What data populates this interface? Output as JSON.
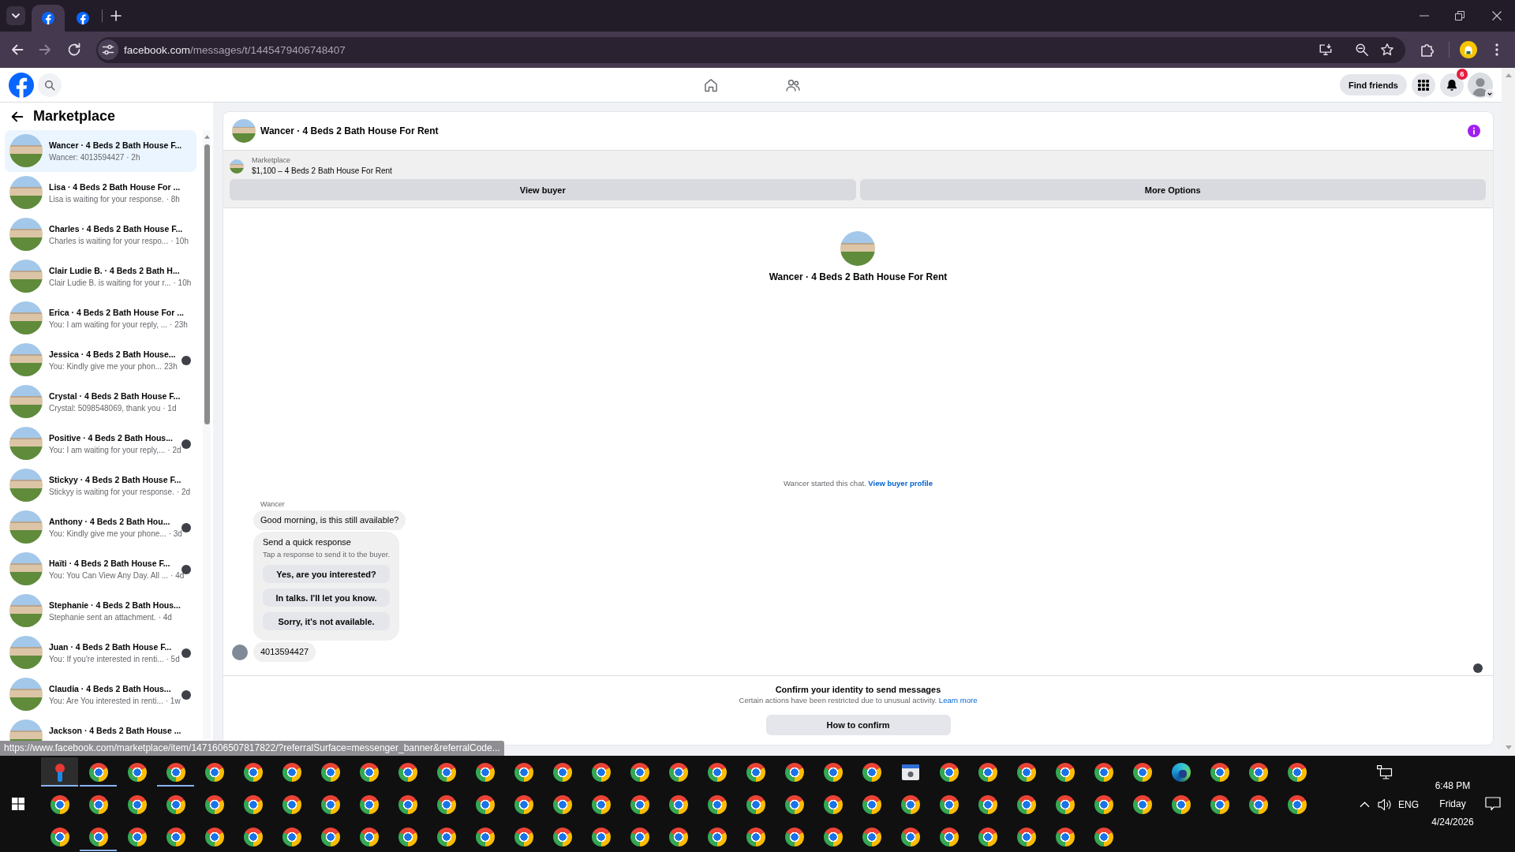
{
  "browser": {
    "tabs": [
      {
        "selected": true
      },
      {
        "selected": false
      }
    ],
    "forward_disabled": true,
    "url_host": "facebook.com",
    "url_path": "/messages/t/1445479406748407"
  },
  "header": {
    "nav": [
      {
        "kind": "home",
        "selected": false
      },
      {
        "kind": "friends",
        "selected": false
      }
    ],
    "find_friends": "Find friends",
    "notification_count": "6"
  },
  "sidebar": {
    "title": "Marketplace",
    "items": [
      {
        "title": "Wancer · 4 Beds 2 Bath House F...",
        "preview": "Wancer: 4013594427",
        "time": "· 2h",
        "selected": true,
        "seen": false
      },
      {
        "title": "Lisa · 4 Beds 2 Bath House For ...",
        "preview": "Lisa is waiting for your response.",
        "time": "· 8h",
        "selected": false,
        "seen": false
      },
      {
        "title": "Charles · 4 Beds 2 Bath House F...",
        "preview": "Charles is waiting for your respo...",
        "time": "· 10h",
        "selected": false,
        "seen": false
      },
      {
        "title": "Clair Ludie B. · 4 Beds 2 Bath H...",
        "preview": "Clair Ludie B. is waiting for your r...",
        "time": "· 10h",
        "selected": false,
        "seen": false
      },
      {
        "title": "Erica · 4 Beds 2 Bath House For ...",
        "preview": "You: I am waiting for your reply, ...",
        "time": "· 23h",
        "selected": false,
        "seen": false
      },
      {
        "title": "Jessica · 4 Beds 2 Bath House...",
        "preview": "You: Kindly give me your phon...",
        "time": "23h",
        "selected": false,
        "seen": true
      },
      {
        "title": "Crystal · 4 Beds 2 Bath House F...",
        "preview": "Crystal: 5098548069, thank you",
        "time": "· 1d",
        "selected": false,
        "seen": false
      },
      {
        "title": "Positive · 4 Beds 2 Bath Hous...",
        "preview": "You: I am waiting for your reply,...",
        "time": "· 2d",
        "selected": false,
        "seen": true
      },
      {
        "title": "Stickyy · 4 Beds 2 Bath House F...",
        "preview": "Stickyy is waiting for your response.",
        "time": "· 2d",
        "selected": false,
        "seen": false
      },
      {
        "title": "Anthony · 4 Beds 2 Bath Hou...",
        "preview": "You: Kindly give me your phone...",
        "time": "· 3d",
        "selected": false,
        "seen": true
      },
      {
        "title": "Haïti · 4 Beds 2 Bath House F...",
        "preview": "You: You Can View Any Day. All ...",
        "time": "· 4d",
        "selected": false,
        "seen": true
      },
      {
        "title": "Stephanie · 4 Beds 2 Bath Hous...",
        "preview": "Stephanie sent an attachment.",
        "time": "· 4d",
        "selected": false,
        "seen": false
      },
      {
        "title": "Juan · 4 Beds 2 Bath House F...",
        "preview": "You: If you're interested in renti...",
        "time": "· 5d",
        "selected": false,
        "seen": true
      },
      {
        "title": "Claudia · 4 Beds 2 Bath Hous...",
        "preview": "You: Are You interested in renti...",
        "time": "· 1w",
        "selected": false,
        "seen": true
      },
      {
        "title": "Jackson · 4 Beds 2 Bath House ...",
        "selected": false,
        "seen": false
      }
    ]
  },
  "chat": {
    "title": "Wancer · 4 Beds 2 Bath House For Rent",
    "listing": {
      "label": "Marketplace",
      "text": "$1,100 – 4 Beds 2 Bath House For Rent"
    },
    "buttons": [
      "View buyer",
      "More Options"
    ],
    "intro_title": "Wancer · 4 Beds 2 Bath House For Rent",
    "started": "Wancer started this chat.",
    "profile_link": "View buyer profile",
    "messages": [
      {
        "kind": "text",
        "sender": "Wancer",
        "text": "Good morning, is this still available?",
        "avatar": false
      },
      {
        "kind": "quick_replies",
        "title": "Send a quick response",
        "subtitle": "Tap a response to send it to the buyer.",
        "options": [
          "Yes, are you interested?",
          "In talks. I'll let you know.",
          "Sorry, it's not available."
        ]
      },
      {
        "kind": "text",
        "text": "4013594427",
        "avatar": true
      }
    ],
    "seen": true,
    "notice": {
      "title": "Confirm your identity to send messages",
      "text": "Certain actions have been restricted due to unusual activity.",
      "link": "Learn more",
      "button": "How to confirm"
    }
  },
  "status_url": "https://www.facebook.com/marketplace/item/1471606507817822/?referralSurface=messenger_banner&referralCode...",
  "taskbar": {
    "rows": [
      [
        {
          "kind": "pin",
          "open": true,
          "selected": true
        },
        {
          "kind": "browser",
          "open": true,
          "selected": false
        },
        {
          "kind": "browser",
          "open": false,
          "selected": false
        },
        {
          "kind": "browser",
          "open": true,
          "selected": false
        },
        {
          "kind": "browser",
          "open": false,
          "selected": false
        },
        {
          "kind": "browser",
          "open": false,
          "selected": false
        },
        {
          "kind": "browser",
          "open": false,
          "selected": false
        },
        {
          "kind": "browser",
          "open": false,
          "selected": false
        },
        {
          "kind": "browser",
          "open": false,
          "selected": false
        },
        {
          "kind": "browser",
          "open": false,
          "selected": false
        },
        {
          "kind": "browser",
          "open": false,
          "selected": false
        },
        {
          "kind": "browser",
          "open": false,
          "selected": false
        },
        {
          "kind": "browser",
          "open": false,
          "selected": false
        },
        {
          "kind": "browser",
          "open": false,
          "selected": false
        },
        {
          "kind": "browser",
          "open": false,
          "selected": false
        },
        {
          "kind": "browser",
          "open": false,
          "selected": false
        },
        {
          "kind": "browser",
          "open": false,
          "selected": false
        },
        {
          "kind": "browser",
          "open": false,
          "selected": false
        },
        {
          "kind": "browser",
          "open": false,
          "selected": false
        },
        {
          "kind": "browser",
          "open": false,
          "selected": false
        },
        {
          "kind": "browser",
          "open": false,
          "selected": false
        },
        {
          "kind": "browser",
          "open": false,
          "selected": false
        },
        {
          "kind": "window",
          "open": false,
          "selected": false
        },
        {
          "kind": "browser",
          "open": false,
          "selected": false
        },
        {
          "kind": "browser",
          "open": false,
          "selected": false
        },
        {
          "kind": "browser",
          "open": false,
          "selected": false
        },
        {
          "kind": "browser",
          "open": false,
          "selected": false
        },
        {
          "kind": "browser",
          "open": false,
          "selected": false
        },
        {
          "kind": "browser",
          "open": false,
          "selected": false
        },
        {
          "kind": "swirl",
          "open": false,
          "selected": false
        },
        {
          "kind": "browser",
          "open": false,
          "selected": false
        },
        {
          "kind": "browser",
          "open": false,
          "selected": false
        },
        {
          "kind": "browser",
          "open": false,
          "selected": false
        }
      ],
      [
        {
          "kind": "browser",
          "open": false,
          "selected": false
        },
        {
          "kind": "browser",
          "open": false,
          "selected": false
        },
        {
          "kind": "browser",
          "open": false,
          "selected": false
        },
        {
          "kind": "browser",
          "open": false,
          "selected": false
        },
        {
          "kind": "browser",
          "open": false,
          "selected": false
        },
        {
          "kind": "browser",
          "open": false,
          "selected": false
        },
        {
          "kind": "browser",
          "open": false,
          "selected": false
        },
        {
          "kind": "browser",
          "open": false,
          "selected": false
        },
        {
          "kind": "browser",
          "open": false,
          "selected": false
        },
        {
          "kind": "browser",
          "open": false,
          "selected": false
        },
        {
          "kind": "browser",
          "open": false,
          "selected": false
        },
        {
          "kind": "browser",
          "open": false,
          "selected": false
        },
        {
          "kind": "browser",
          "open": false,
          "selected": false
        },
        {
          "kind": "browser",
          "open": false,
          "selected": false
        },
        {
          "kind": "browser",
          "open": false,
          "selected": false
        },
        {
          "kind": "browser",
          "open": false,
          "selected": false
        },
        {
          "kind": "browser",
          "open": false,
          "selected": false
        },
        {
          "kind": "browser",
          "open": false,
          "selected": false
        },
        {
          "kind": "browser",
          "open": false,
          "selected": false
        },
        {
          "kind": "browser",
          "open": false,
          "selected": false
        },
        {
          "kind": "browser",
          "open": false,
          "selected": false
        },
        {
          "kind": "browser",
          "open": false,
          "selected": false
        },
        {
          "kind": "browser",
          "open": false,
          "selected": false
        },
        {
          "kind": "browser",
          "open": false,
          "selected": false
        },
        {
          "kind": "browser",
          "open": false,
          "selected": false
        },
        {
          "kind": "browser",
          "open": false,
          "selected": false
        },
        {
          "kind": "browser",
          "open": false,
          "selected": false
        },
        {
          "kind": "browser",
          "open": false,
          "selected": false
        },
        {
          "kind": "browser",
          "open": false,
          "selected": false
        },
        {
          "kind": "browser",
          "open": false,
          "selected": false
        },
        {
          "kind": "browser",
          "open": false,
          "selected": false
        },
        {
          "kind": "browser",
          "open": false,
          "selected": false
        },
        {
          "kind": "browser",
          "open": false,
          "selected": false
        }
      ],
      [
        {
          "kind": "browser",
          "open": false,
          "selected": false
        },
        {
          "kind": "browser",
          "open": true,
          "selected": false
        },
        {
          "kind": "browser",
          "open": false,
          "selected": false
        },
        {
          "kind": "browser",
          "open": false,
          "selected": false
        },
        {
          "kind": "browser",
          "open": false,
          "selected": false
        },
        {
          "kind": "browser",
          "open": false,
          "selected": false
        },
        {
          "kind": "browser",
          "open": false,
          "selected": false
        },
        {
          "kind": "browser",
          "open": false,
          "selected": false
        },
        {
          "kind": "browser",
          "open": false,
          "selected": false
        },
        {
          "kind": "browser",
          "open": false,
          "selected": false
        },
        {
          "kind": "browser",
          "open": false,
          "selected": false
        },
        {
          "kind": "browser",
          "open": false,
          "selected": false
        },
        {
          "kind": "browser",
          "open": false,
          "selected": false
        },
        {
          "kind": "browser",
          "open": false,
          "selected": false
        },
        {
          "kind": "browser",
          "open": false,
          "selected": false
        },
        {
          "kind": "browser",
          "open": false,
          "selected": false
        },
        {
          "kind": "browser",
          "open": false,
          "selected": false
        },
        {
          "kind": "browser",
          "open": false,
          "selected": false
        },
        {
          "kind": "browser",
          "open": false,
          "selected": false
        },
        {
          "kind": "browser",
          "open": false,
          "selected": false
        },
        {
          "kind": "browser",
          "open": false,
          "selected": false
        },
        {
          "kind": "browser",
          "open": false,
          "selected": false
        },
        {
          "kind": "browser",
          "open": false,
          "selected": false
        },
        {
          "kind": "browser",
          "open": false,
          "selected": false
        },
        {
          "kind": "browser",
          "open": false,
          "selected": false
        },
        {
          "kind": "browser",
          "open": false,
          "selected": false
        },
        {
          "kind": "browser",
          "open": false,
          "selected": false
        },
        {
          "kind": "browser",
          "open": false,
          "selected": false
        }
      ]
    ],
    "tray": {
      "language": "ENG",
      "time": "6:48 PM",
      "day": "Friday",
      "date": "4/24/2026"
    }
  }
}
